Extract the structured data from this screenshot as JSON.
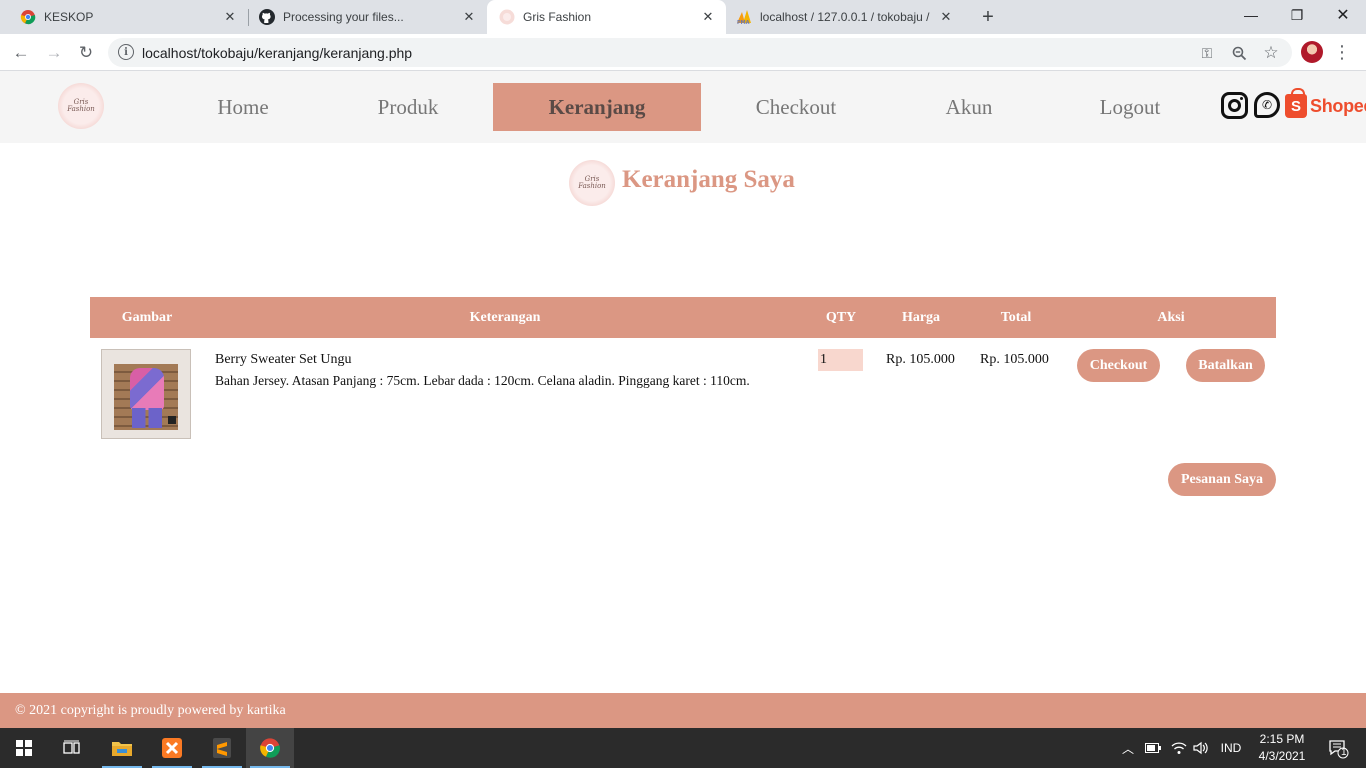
{
  "browser": {
    "tabs": [
      {
        "title": "KESKOP",
        "active": false
      },
      {
        "title": "Processing your files...",
        "active": false
      },
      {
        "title": "Gris Fashion",
        "active": true
      },
      {
        "title": "localhost / 127.0.0.1 / tokobaju /",
        "active": false
      }
    ],
    "url": "localhost/tokobaju/keranjang/keranjang.php"
  },
  "site": {
    "logo_text_line1": "Gris",
    "logo_text_line2": "Fashion",
    "nav": [
      {
        "label": "Home",
        "active": false
      },
      {
        "label": "Produk",
        "active": false
      },
      {
        "label": "Keranjang",
        "active": true
      },
      {
        "label": "Checkout",
        "active": false
      },
      {
        "label": "Akun",
        "active": false
      },
      {
        "label": "Logout",
        "active": false
      }
    ],
    "social": {
      "shopee_label": "Shopee"
    }
  },
  "page": {
    "title": "Keranjang Saya"
  },
  "cart": {
    "headers": [
      "Gambar",
      "Keterangan",
      "QTY",
      "Harga",
      "Total",
      "Aksi"
    ],
    "rows": [
      {
        "name": "Berry Sweater Set Ungu",
        "description": "Bahan Jersey. Atasan Panjang : 75cm. Lebar dada : 120cm. Celana aladin. Pinggang karet : 110cm.",
        "qty": "1",
        "price": "Rp. 105.000",
        "total": "Rp. 105.000",
        "checkout_label": "Checkout",
        "cancel_label": "Batalkan"
      }
    ],
    "my_orders_label": "Pesanan Saya"
  },
  "footer": {
    "text": "© 2021 copyright is proudly powered by kartika"
  },
  "taskbar": {
    "language": "IND",
    "time": "2:15 PM",
    "date": "4/3/2021",
    "notification_count": "1"
  },
  "colors": {
    "accent": "#db9783",
    "qty_bg": "#f8d7ce",
    "header_bg": "#f5f5f5"
  }
}
